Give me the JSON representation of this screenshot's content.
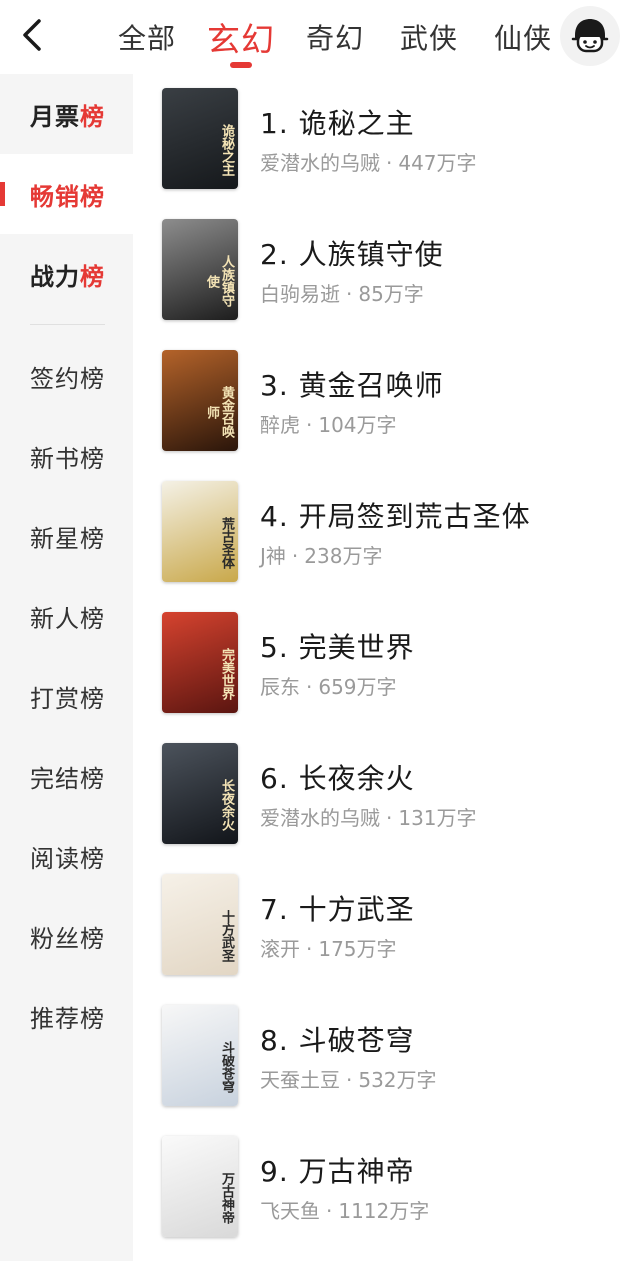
{
  "header": {
    "tabs": [
      {
        "label": "全部"
      },
      {
        "label": "玄幻"
      },
      {
        "label": "奇幻"
      },
      {
        "label": "武侠"
      },
      {
        "label": "仙侠"
      }
    ],
    "active_tab_index": 1
  },
  "sidebar": {
    "items": [
      {
        "prefix": "月票",
        "suffix": "榜"
      },
      {
        "prefix": "畅销",
        "suffix": "榜"
      },
      {
        "prefix": "战力",
        "suffix": "榜"
      },
      {
        "label": "签约榜"
      },
      {
        "label": "新书榜"
      },
      {
        "label": "新星榜"
      },
      {
        "label": "新人榜"
      },
      {
        "label": "打赏榜"
      },
      {
        "label": "完结榜"
      },
      {
        "label": "阅读榜"
      },
      {
        "label": "粉丝榜"
      },
      {
        "label": "推荐榜"
      }
    ],
    "active_index": 1
  },
  "books": [
    {
      "title": "1. 诡秘之主",
      "author": "爱潜水的乌贼",
      "sep": "·",
      "words": "447万字",
      "cover_text": "诡秘之主",
      "cover_colors": [
        "#3a3f44",
        "#15181b"
      ]
    },
    {
      "title": "2. 人族镇守使",
      "author": "白驹易逝",
      "sep": "·",
      "words": "85万字",
      "cover_text": "人族镇守使",
      "cover_colors": [
        "#8d8d8d",
        "#1d1d1d"
      ]
    },
    {
      "title": "3. 黄金召唤师",
      "author": "醉虎",
      "sep": "·",
      "words": "104万字",
      "cover_text": "黄金召唤师",
      "cover_colors": [
        "#b4632a",
        "#2a150a"
      ]
    },
    {
      "title": "4. 开局签到荒古圣体",
      "author": "J神",
      "sep": "·",
      "words": "238万字",
      "cover_text": "荒古圣体",
      "cover_colors": [
        "#f4f1e6",
        "#c9a84a"
      ]
    },
    {
      "title": "5. 完美世界",
      "author": "辰东",
      "sep": "·",
      "words": "659万字",
      "cover_text": "完美世界",
      "cover_colors": [
        "#d6432f",
        "#5a1510"
      ]
    },
    {
      "title": "6. 长夜余火",
      "author": "爱潜水的乌贼",
      "sep": "·",
      "words": "131万字",
      "cover_text": "长夜余火",
      "cover_colors": [
        "#4c535c",
        "#12151a"
      ]
    },
    {
      "title": "7. 十方武圣",
      "author": "滚开",
      "sep": "·",
      "words": "175万字",
      "cover_text": "十方武圣",
      "cover_colors": [
        "#f6f1e8",
        "#e2d6c4"
      ]
    },
    {
      "title": "8. 斗破苍穹",
      "author": "天蚕土豆",
      "sep": "·",
      "words": "532万字",
      "cover_text": "斗破苍穹",
      "cover_colors": [
        "#f7f7f7",
        "#c8d2de"
      ]
    },
    {
      "title": "9. 万古神帝",
      "author": "飞天鱼",
      "sep": "·",
      "words": "1112万字",
      "cover_text": "万古神帝",
      "cover_colors": [
        "#fafafa",
        "#d9d9d9"
      ]
    }
  ],
  "colors": {
    "accent": "#e53935",
    "muted": "#9a9a9a"
  }
}
